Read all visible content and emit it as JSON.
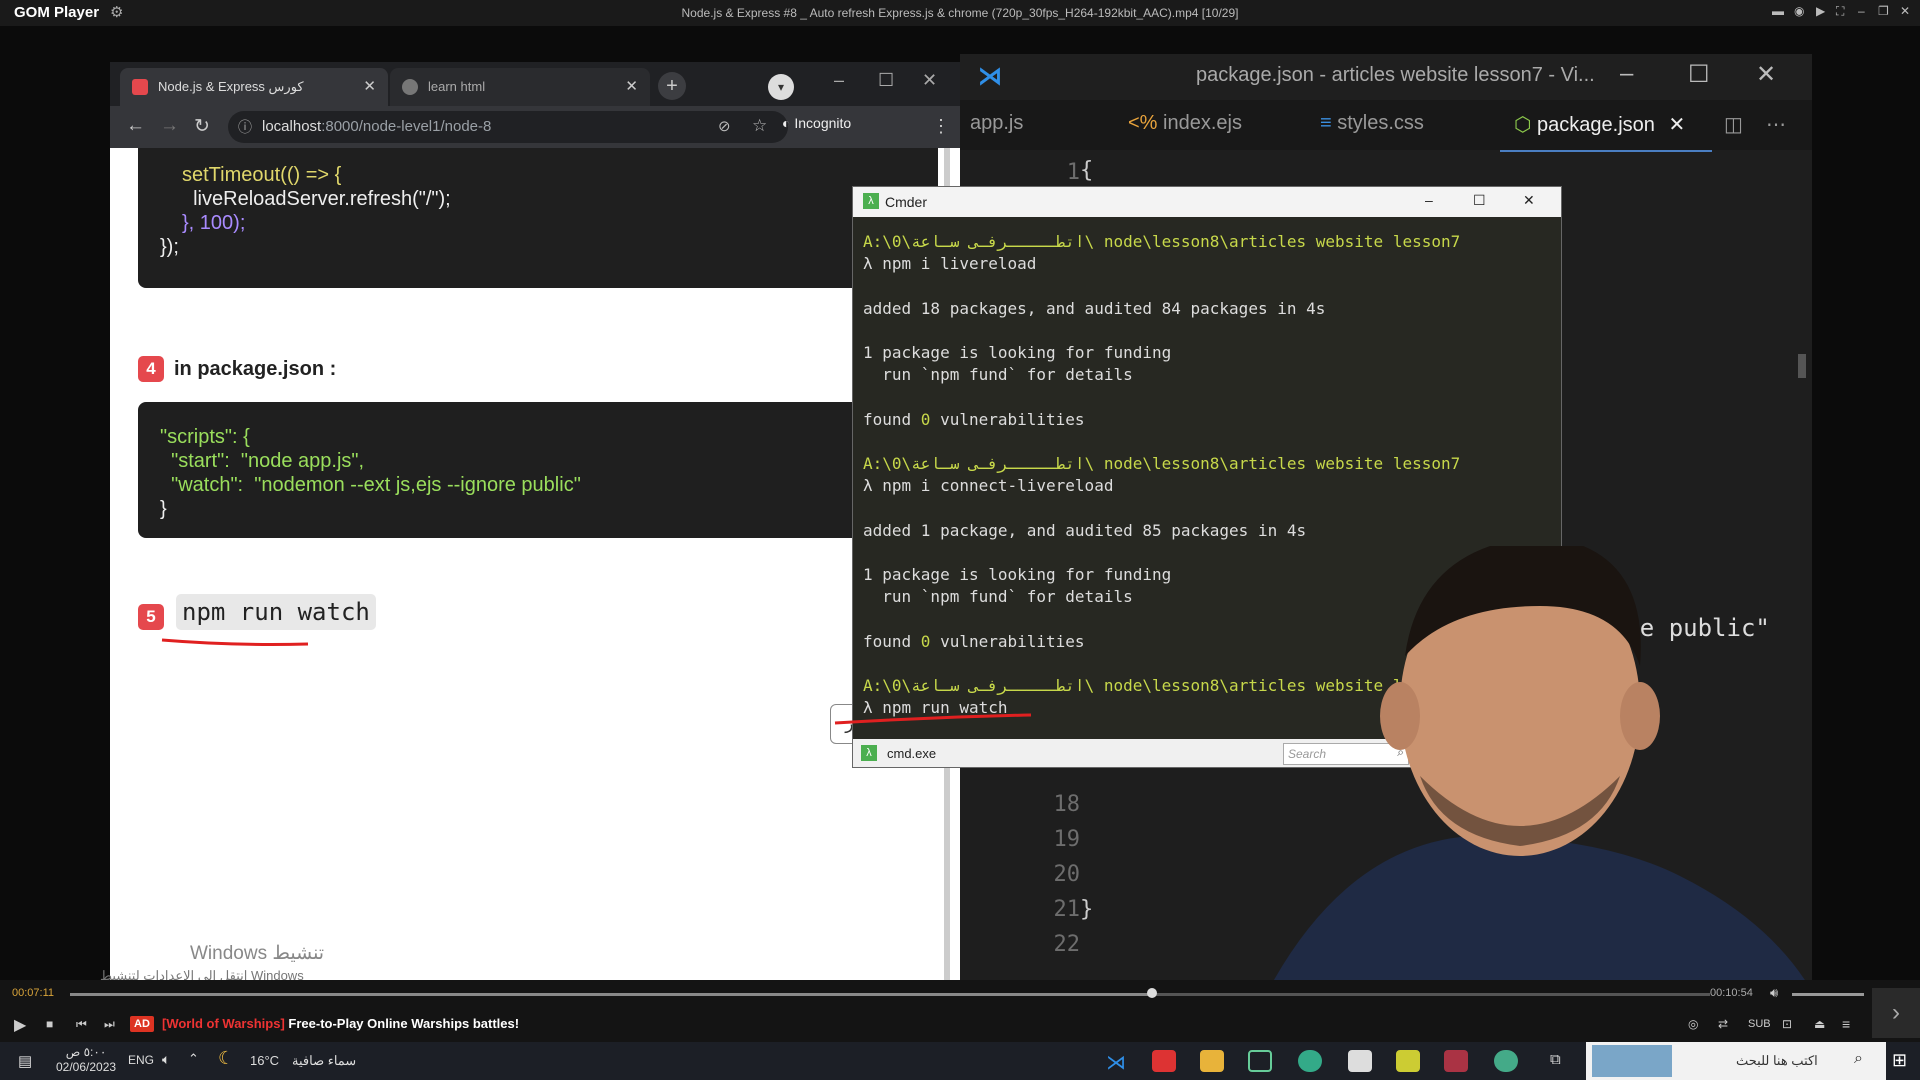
{
  "player": {
    "logo": "GOM Player",
    "file_title": "Node.js & Express #8 _ Auto refresh Express.js & chrome (720p_30fps_H264-192kbit_AAC).mp4 [10/29]",
    "time_elapsed": "00:07:11",
    "time_total": "00:10:54",
    "progress_fraction": 0.66,
    "ad_badge": "AD",
    "ad_brand": "[World of Warships]",
    "ad_text": "Free-to-Play Online Warships battles!"
  },
  "browser": {
    "tabs": [
      {
        "label": "Node.js & Express كورس",
        "active": true
      },
      {
        "label": "learn html",
        "active": false
      }
    ],
    "url_host": "localhost",
    "url_path": ":8000/node-level1/node-8",
    "incognito_label": "Incognito"
  },
  "lesson": {
    "code1_lines": [
      "setTimeout(() => {",
      "  liveReloadServer.refresh(\"/\");",
      "}, 100);",
      "});"
    ],
    "step4_number": "4",
    "step4_text": "in package.json :",
    "code2_lines": [
      "\"scripts\": {",
      "  \"start\":  \"node app.js\",",
      "  \"watch\":  \"nodemon --ext js,ejs --ignore public\"",
      "}"
    ],
    "step5_number": "5",
    "step5_text": "npm run watch",
    "source_button": "المصدر",
    "windows_activate_1": "Windows تنشيط",
    "windows_activate_2": "انتقل إلى الإعدادات لتنشيط Windows"
  },
  "vscode": {
    "title": "package.json - articles website lesson7 - Vi...",
    "tabs": [
      {
        "label": "app.js",
        "icon": "js-icon"
      },
      {
        "label": "index.ejs",
        "icon": "ejs-icon"
      },
      {
        "label": "styles.css",
        "icon": "css-icon"
      },
      {
        "label": "package.json",
        "icon": "node-icon",
        "active": true
      }
    ],
    "line_numbers": [
      "1",
      "18",
      "19",
      "20",
      "21",
      "22"
    ],
    "open_brace": "{",
    "close_brace": "}",
    "faded_code": "gnore public\""
  },
  "cmder": {
    "title": "Cmder",
    "prompt_path": "A:\\0\\اتطـــــرفـى سـاعة\\ node\\lesson8\\articles website lesson7",
    "prompt_path_short": "A:\\0\\اتطـــــرفـى سـاعة\\ node\\lesson8\\articles website lesson",
    "cmd1": "λ npm i livereload",
    "out1": "added 18 packages, and audited 84 packages in 4s",
    "funding1": "1 package is looking for funding",
    "funding2": "  run `npm fund` for details",
    "found_pre": "found ",
    "found_zero": "0",
    "found_post": " vulnerabilities",
    "cmd2": "λ npm i connect-livereload",
    "out2": "added 1 package, and audited 85 packages in 4s",
    "cmd3": "λ npm run watch",
    "status_tab": "cmd.exe",
    "search_placeholder": "Search"
  },
  "taskbar": {
    "time": "٥:٠٠ ص",
    "date": "02/06/2023",
    "lang": "ENG",
    "weather_temp": "16°C",
    "weather_text": "سماء صافية",
    "search_placeholder": "اكتب هنا للبحث"
  },
  "colors": {
    "accent_red": "#e5484d",
    "vscode_blue": "#2f8fe8",
    "cmder_path": "#c7d84a"
  }
}
